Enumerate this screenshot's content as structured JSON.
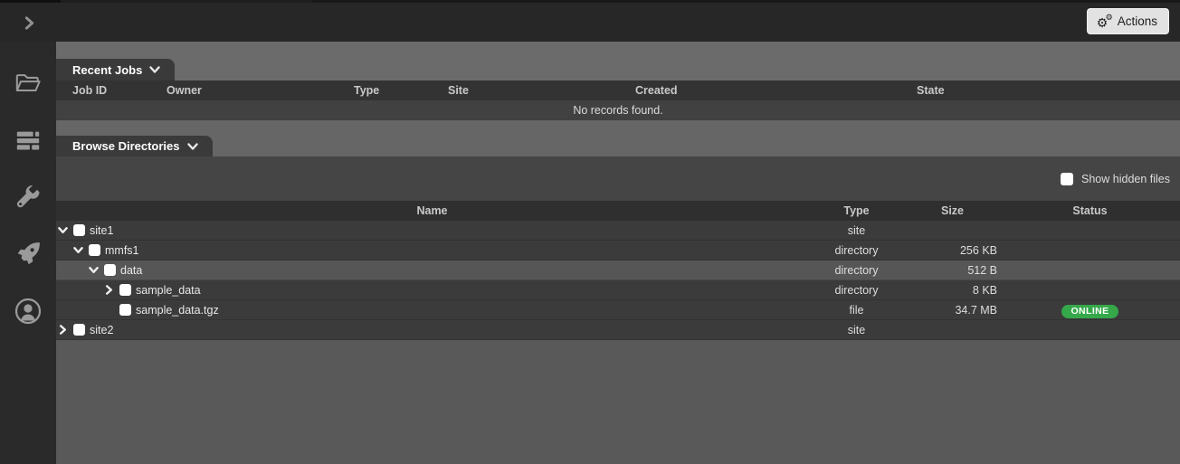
{
  "topbar": {
    "actions_label": "Actions"
  },
  "sidebar": {
    "icons": [
      "folder-open",
      "job-queue",
      "wrench",
      "rocket",
      "user-account"
    ]
  },
  "recent_jobs": {
    "title": "Recent Jobs",
    "columns": [
      "Job ID",
      "Owner",
      "Type",
      "Site",
      "Created",
      "State"
    ],
    "empty_message": "No records found."
  },
  "browse": {
    "title": "Browse Directories",
    "show_hidden_label": "Show hidden files",
    "columns": [
      "Name",
      "Type",
      "Size",
      "Status"
    ],
    "rows": [
      {
        "name": "site1",
        "level": 0,
        "has_children": true,
        "expanded": true,
        "checked": false,
        "selected": false,
        "type": "site",
        "size": "",
        "status": ""
      },
      {
        "name": "mmfs1",
        "level": 1,
        "has_children": true,
        "expanded": true,
        "checked": false,
        "selected": false,
        "type": "directory",
        "size": "256 KB",
        "status": ""
      },
      {
        "name": "data",
        "level": 2,
        "has_children": true,
        "expanded": true,
        "checked": false,
        "selected": true,
        "type": "directory",
        "size": "512 B",
        "status": ""
      },
      {
        "name": "sample_data",
        "level": 3,
        "has_children": true,
        "expanded": false,
        "checked": false,
        "selected": false,
        "type": "directory",
        "size": "8 KB",
        "status": ""
      },
      {
        "name": "sample_data.tgz",
        "level": 3,
        "has_children": false,
        "expanded": false,
        "checked": false,
        "selected": false,
        "type": "file",
        "size": "34.7 MB",
        "status": "ONLINE"
      },
      {
        "name": "site2",
        "level": 0,
        "has_children": true,
        "expanded": false,
        "checked": false,
        "selected": false,
        "type": "site",
        "size": "",
        "status": ""
      }
    ]
  },
  "colors": {
    "status_online_green": "#35a84a",
    "badge_text": "#ffffff"
  }
}
